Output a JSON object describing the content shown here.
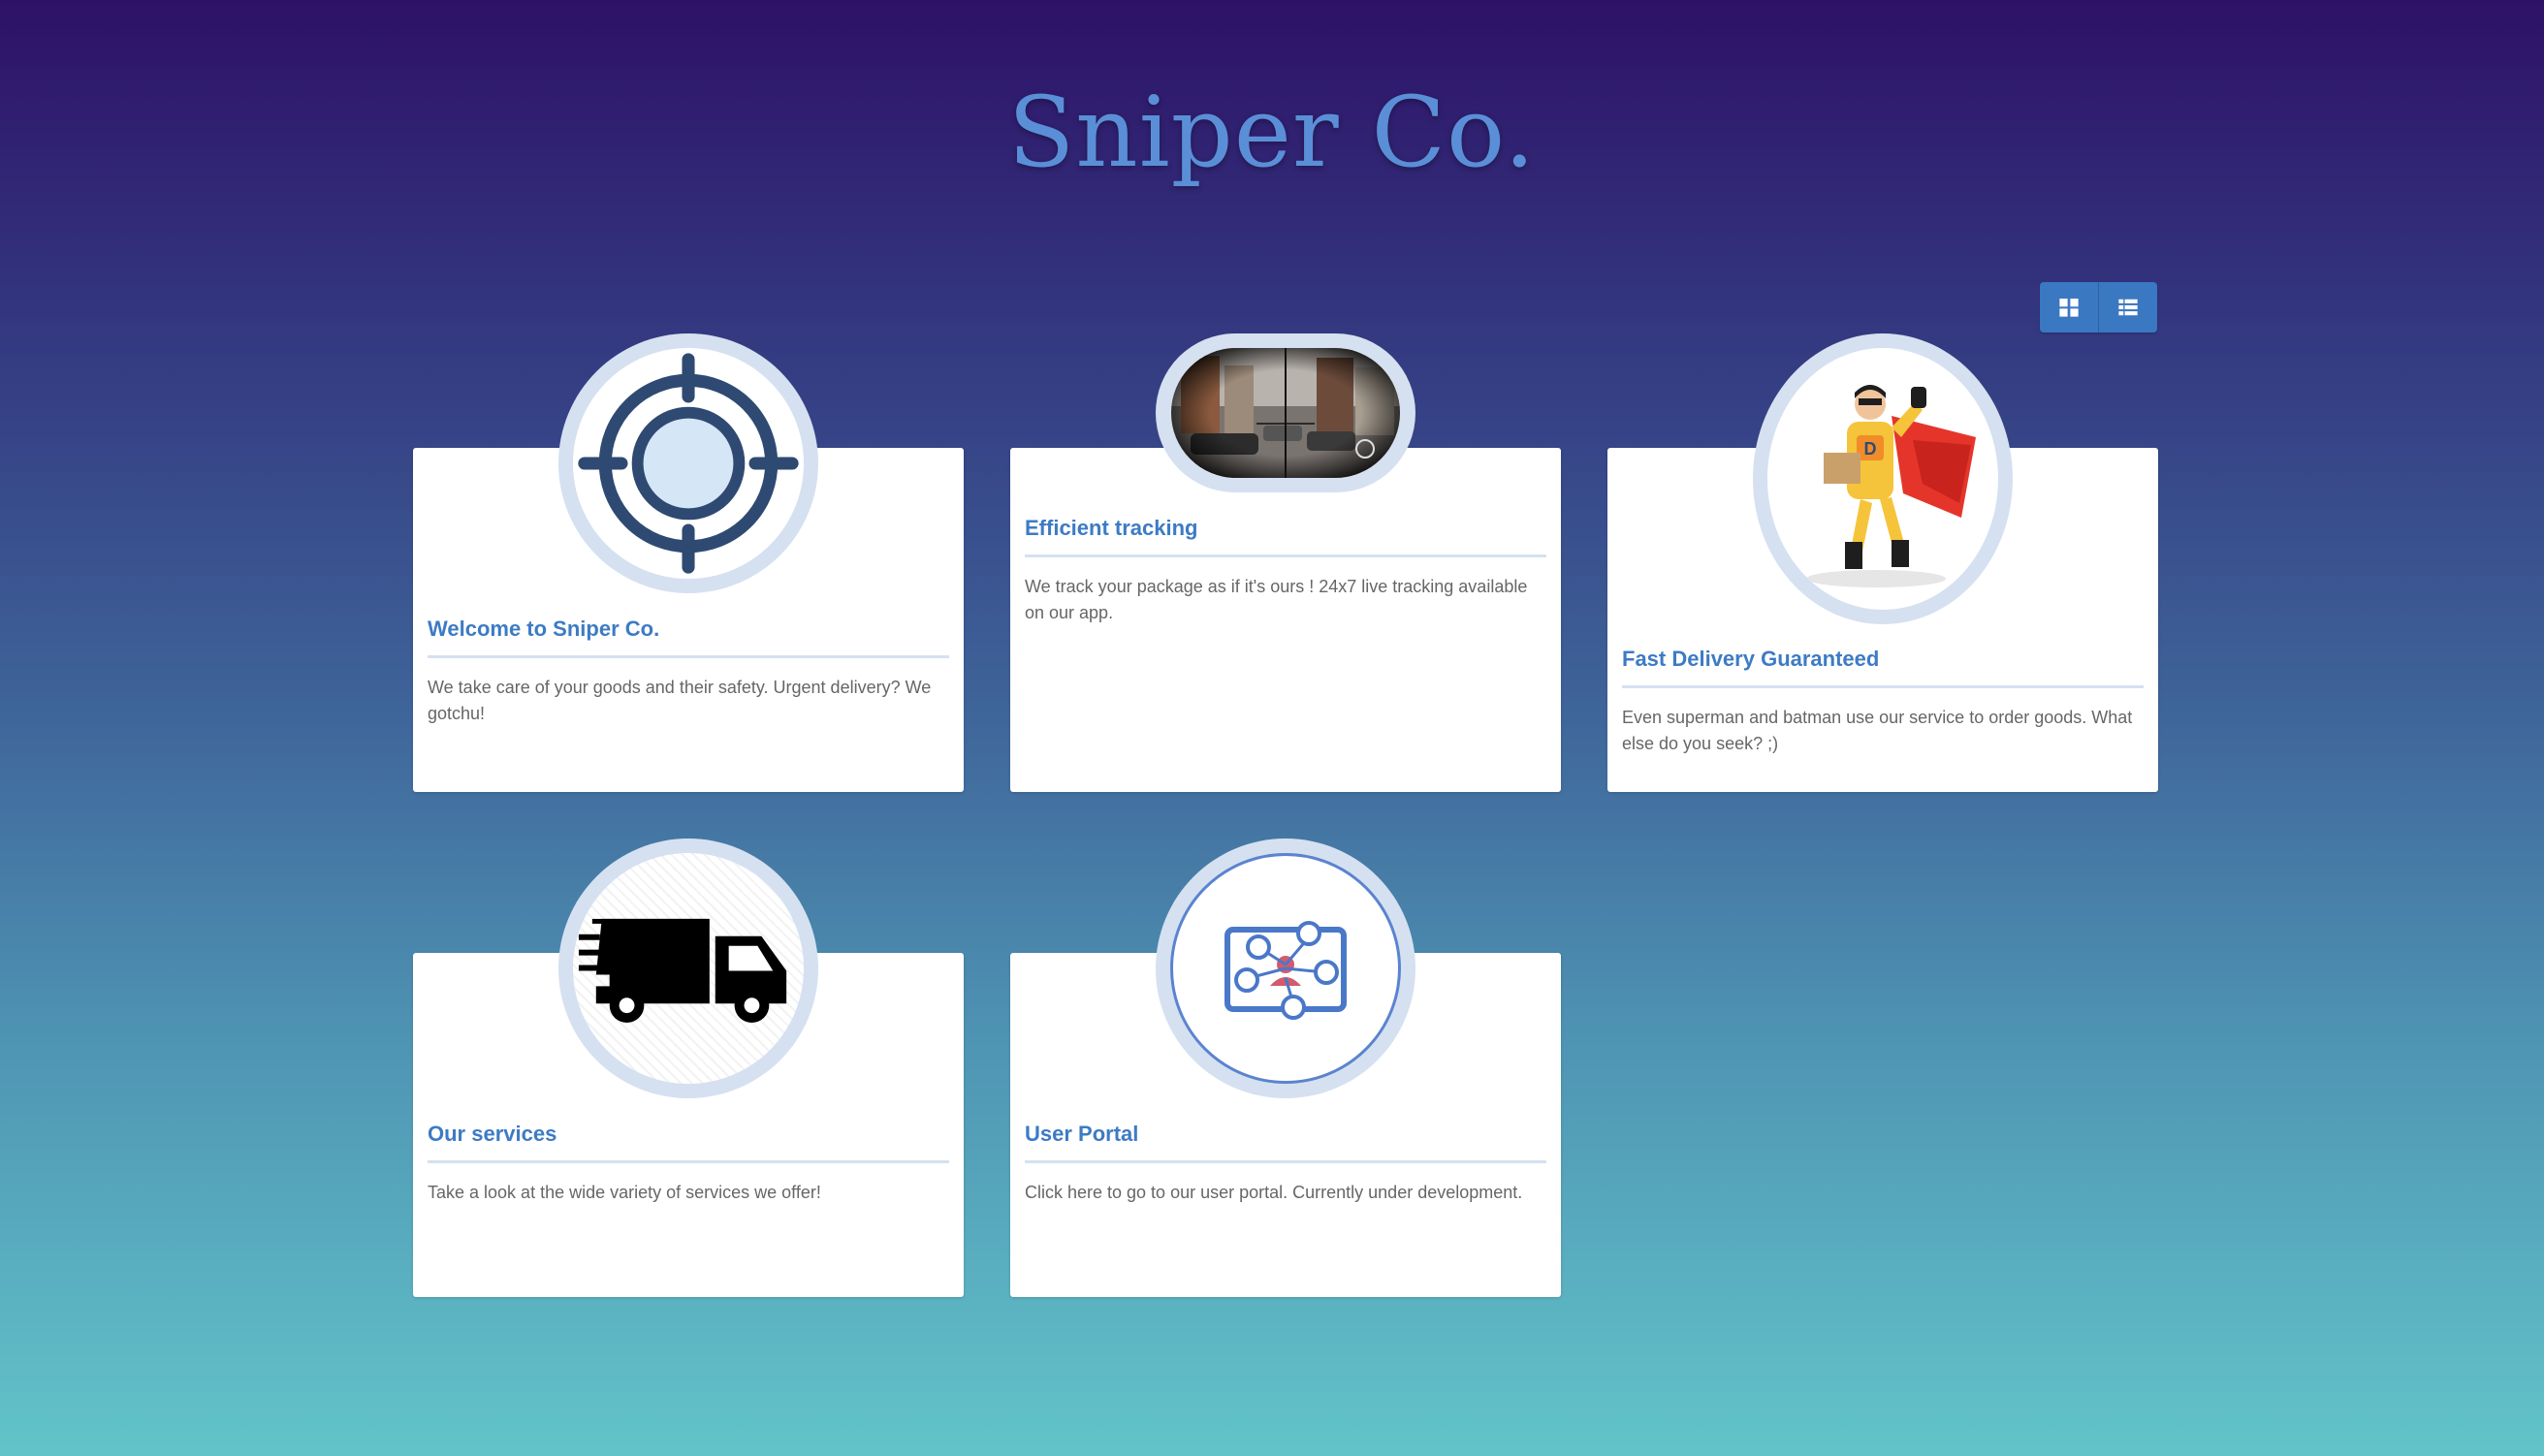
{
  "site": {
    "title": "Sniper Co."
  },
  "toolbar": {
    "grid_view_icon": "grid-view-icon",
    "list_view_icon": "list-view-icon"
  },
  "cards": [
    {
      "title": "Welcome to Sniper Co.",
      "text": "We take care of your goods and their safety. Urgent delivery? We gotchu!",
      "icon": "crosshair-icon"
    },
    {
      "title": "Efficient tracking",
      "text": "We track your package as if it's ours ! 24x7 live tracking available on our app.",
      "icon": "scope-view-image"
    },
    {
      "title": "Fast Delivery Guaranteed",
      "text": "Even superman and batman use our service to order goods. What else do you seek? ;)",
      "icon": "superhero-courier-image"
    },
    {
      "title": "Our services",
      "text": "Take a look at the wide variety of services we offer!",
      "icon": "delivery-truck-icon"
    },
    {
      "title": "User Portal",
      "text": "Click here to go to our user portal. Currently under development.",
      "icon": "user-network-icon"
    }
  ],
  "colors": {
    "accent": "#3d7bc4",
    "title": "#5a8fd8",
    "gradient_top": "#2e1167",
    "gradient_bottom": "#62c4c9",
    "media_ring": "#d5e1f0"
  }
}
